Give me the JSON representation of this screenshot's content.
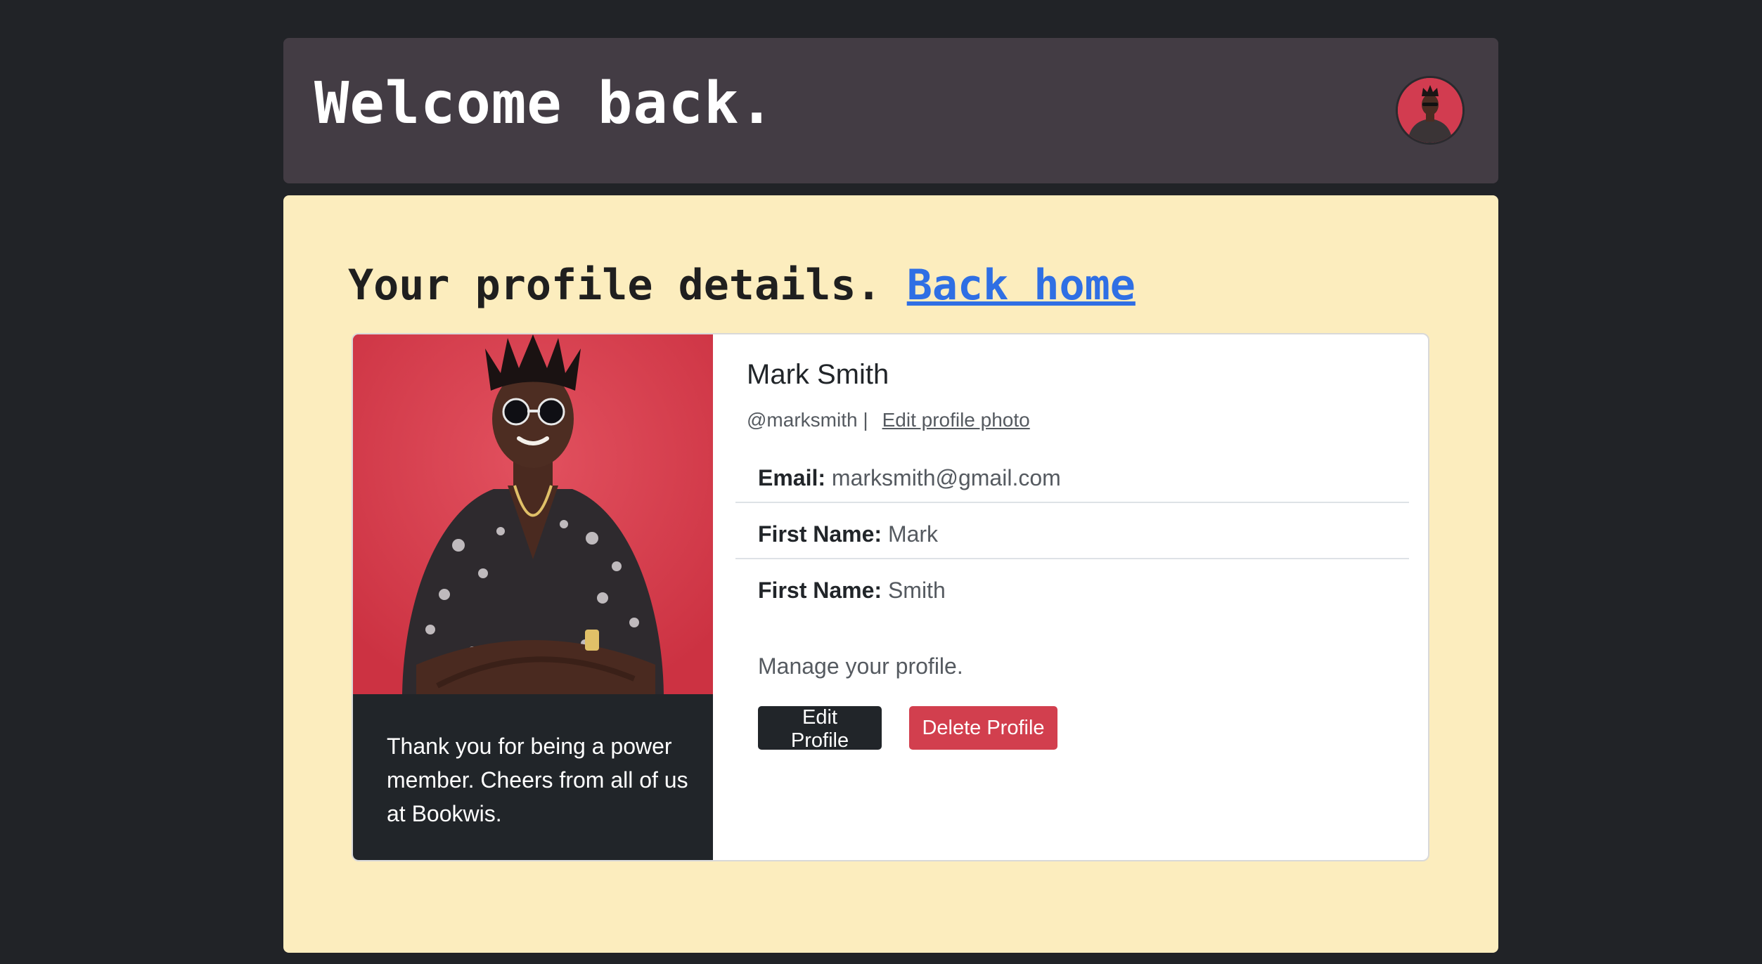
{
  "header": {
    "title": "Welcome back."
  },
  "profile_section": {
    "title": "Your profile details.",
    "back_home_label": "Back home"
  },
  "card": {
    "caption": "Thank you for being a power member. Cheers from all of us at Bookwis.",
    "user": {
      "full_name": "Mark Smith",
      "handle": "@marksmith |",
      "edit_photo_label": "Edit profile photo"
    },
    "details": [
      {
        "label": "Email:",
        "value": "marksmith@gmail.com"
      },
      {
        "label": "First Name:",
        "value": "Mark"
      },
      {
        "label": "First Name:",
        "value": "Smith"
      }
    ],
    "manage_text": "Manage your profile.",
    "edit_button_label": "Edit Profile",
    "delete_button_label": "Delete Profile"
  },
  "colors": {
    "page_background": "#212327",
    "header_background": "#433c44",
    "panel_background": "#fcedbe",
    "link_blue": "#2f6fe4",
    "dark_button": "#212529",
    "danger_button": "#d23f4e",
    "photo_background": "#d63a4e"
  }
}
